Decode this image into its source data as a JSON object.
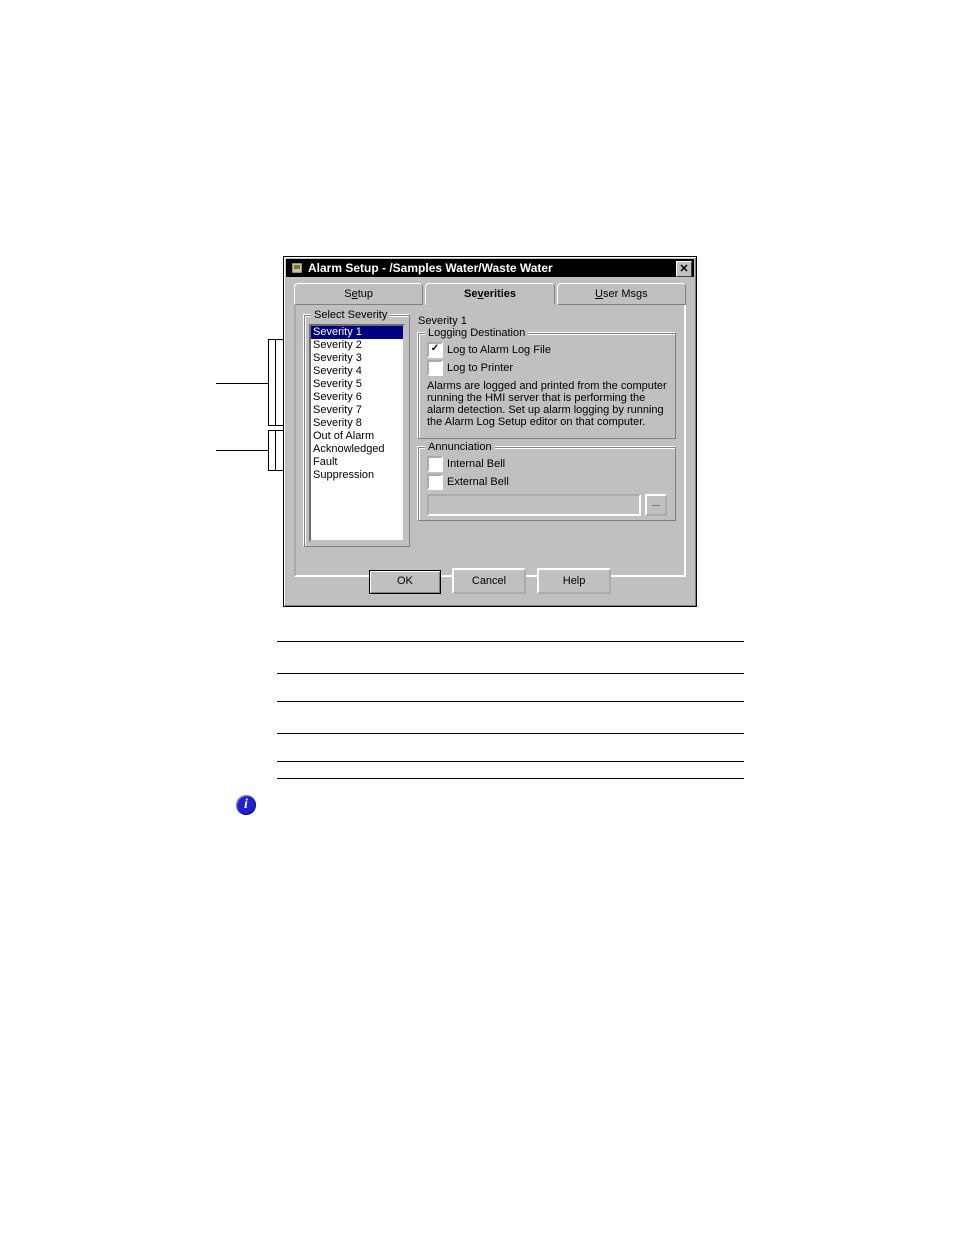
{
  "window": {
    "title": "Alarm Setup - /Samples Water/Waste Water"
  },
  "tabs": {
    "setup": "Setup",
    "severities": "Severities",
    "user_msgs": "User Msgs"
  },
  "sev_group_label": "Select Severity",
  "severities": [
    "Severity 1",
    "Severity 2",
    "Severity 3",
    "Severity 4",
    "Severity 5",
    "Severity 6",
    "Severity 7",
    "Severity 8",
    "Out of Alarm",
    "Acknowledged",
    "Fault",
    "Suppression"
  ],
  "selected_severity_label": "Severity 1",
  "logging": {
    "legend": "Logging Destination",
    "log_file": {
      "label": "Log to Alarm Log File",
      "checked": true
    },
    "printer": {
      "label": "Log to Printer",
      "checked": false
    },
    "note": "Alarms are logged and printed from the computer running the HMI server that is performing the alarm detection. Set up alarm logging by running the Alarm Log Setup editor on that computer."
  },
  "annunciation": {
    "legend": "Annunciation",
    "internal": {
      "label": "Internal Bell",
      "checked": false
    },
    "external": {
      "label": "External Bell",
      "checked": false
    },
    "external_path": "",
    "browse_label": "..."
  },
  "buttons": {
    "ok": "OK",
    "cancel": "Cancel",
    "help": "Help"
  },
  "info_icon_glyph": "i"
}
